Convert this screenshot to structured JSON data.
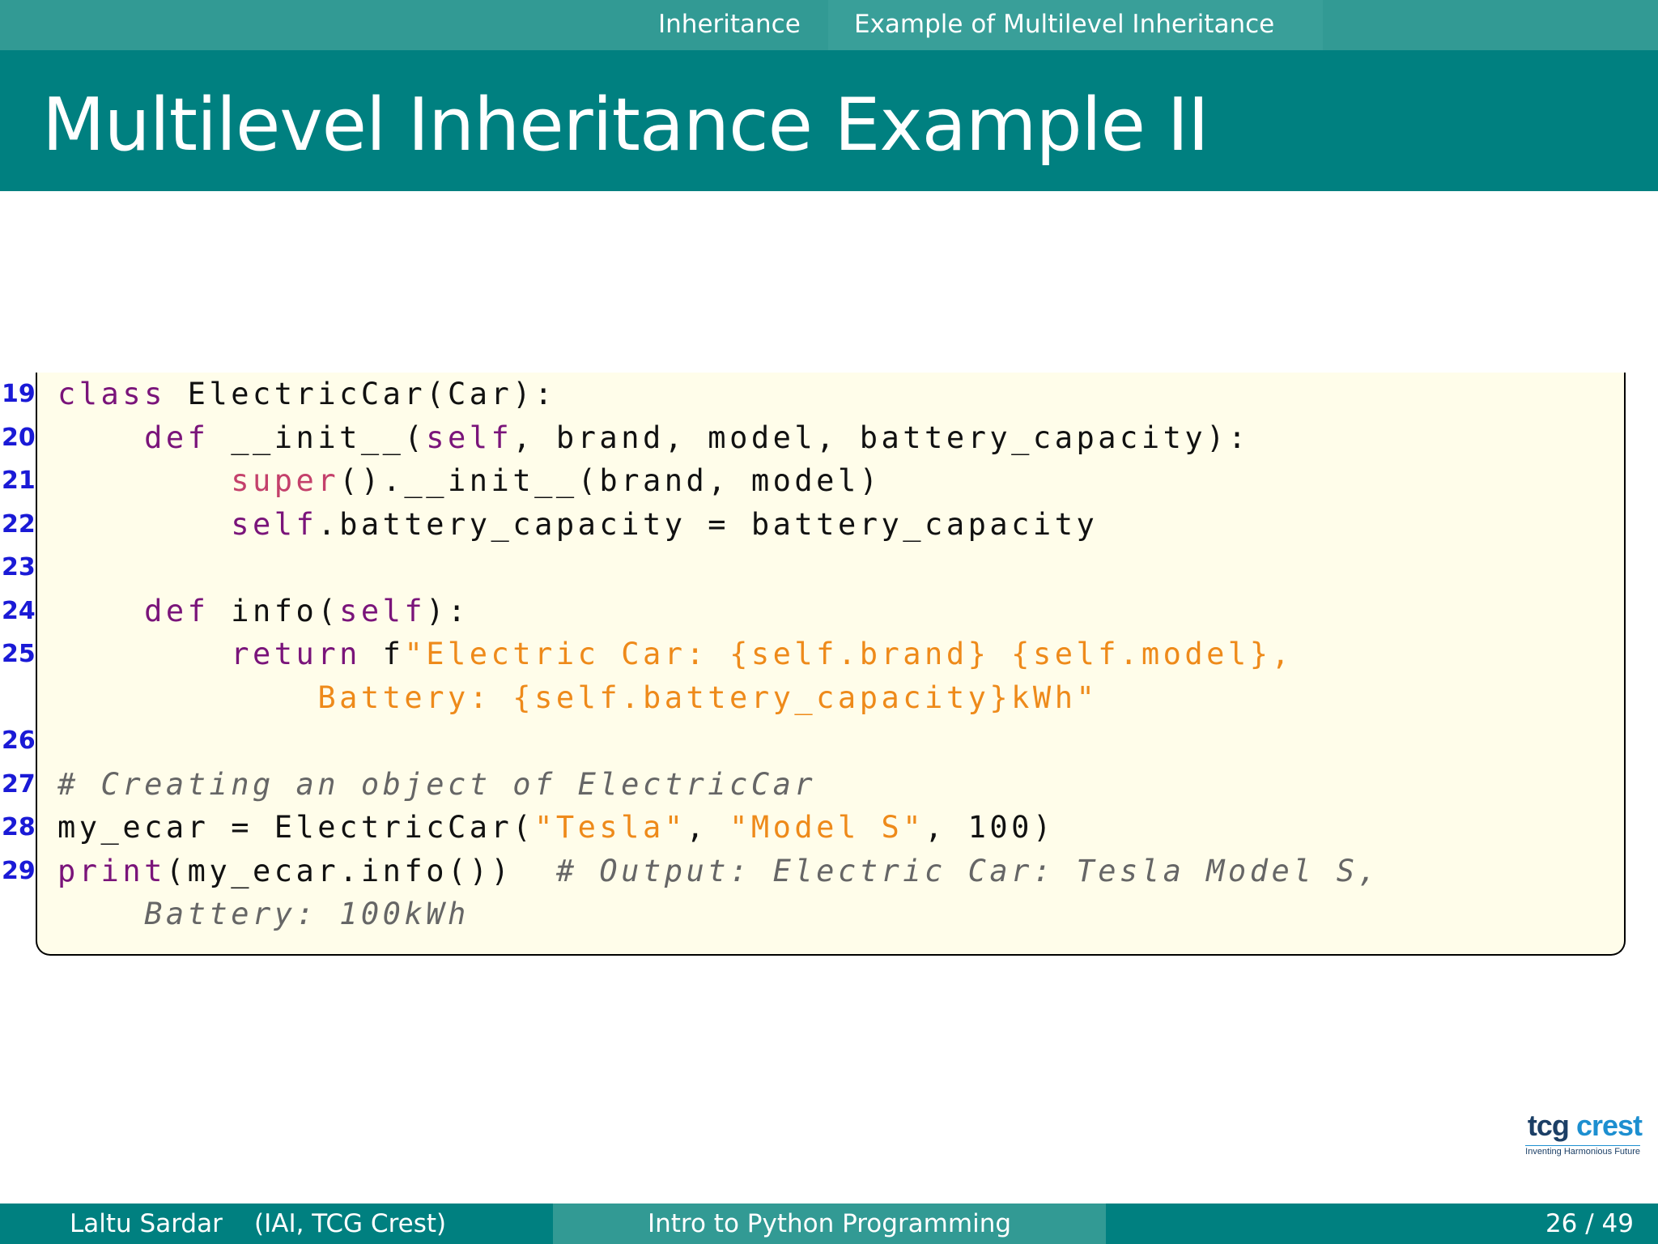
{
  "nav": {
    "section": "Inheritance",
    "subsection": "Example of Multilevel Inheritance"
  },
  "slide": {
    "title": "Multilevel Inheritance Example II"
  },
  "code": {
    "lines": [
      {
        "no": "19",
        "tokens": [
          {
            "t": "class",
            "c": "kw"
          },
          {
            "t": " ElectricCar(Car):",
            "c": ""
          }
        ]
      },
      {
        "no": "20",
        "tokens": [
          {
            "t": "    ",
            "c": ""
          },
          {
            "t": "def",
            "c": "kw"
          },
          {
            "t": " __init__(",
            "c": ""
          },
          {
            "t": "self",
            "c": "kw"
          },
          {
            "t": ", brand, model, battery_capacity):",
            "c": ""
          }
        ]
      },
      {
        "no": "21",
        "tokens": [
          {
            "t": "        ",
            "c": ""
          },
          {
            "t": "super",
            "c": "bi"
          },
          {
            "t": "().__init__(brand, model)",
            "c": ""
          }
        ]
      },
      {
        "no": "22",
        "tokens": [
          {
            "t": "        ",
            "c": ""
          },
          {
            "t": "self",
            "c": "kw"
          },
          {
            "t": ".battery_capacity = battery_capacity",
            "c": ""
          }
        ]
      },
      {
        "no": "23",
        "tokens": []
      },
      {
        "no": "24",
        "tokens": [
          {
            "t": "    ",
            "c": ""
          },
          {
            "t": "def",
            "c": "kw"
          },
          {
            "t": " info(",
            "c": ""
          },
          {
            "t": "self",
            "c": "kw"
          },
          {
            "t": "):",
            "c": ""
          }
        ]
      },
      {
        "no": "25",
        "tokens": [
          {
            "t": "        ",
            "c": ""
          },
          {
            "t": "return",
            "c": "kw"
          },
          {
            "t": " f",
            "c": ""
          },
          {
            "t": "\"Electric Car: {self.brand} {self.model},",
            "c": "str"
          }
        ]
      },
      {
        "no": "",
        "tokens": [
          {
            "t": "            ",
            "c": ""
          },
          {
            "t": "Battery: {self.battery_capacity}kWh\"",
            "c": "str"
          }
        ]
      },
      {
        "no": "26",
        "tokens": []
      },
      {
        "no": "27",
        "tokens": [
          {
            "t": "# Creating an object of ElectricCar",
            "c": "cm"
          }
        ]
      },
      {
        "no": "28",
        "tokens": [
          {
            "t": "my_ecar = ElectricCar(",
            "c": ""
          },
          {
            "t": "\"Tesla\"",
            "c": "str"
          },
          {
            "t": ", ",
            "c": ""
          },
          {
            "t": "\"Model S\"",
            "c": "str"
          },
          {
            "t": ", 100)",
            "c": ""
          }
        ]
      },
      {
        "no": "29",
        "tokens": [
          {
            "t": "print",
            "c": "kw"
          },
          {
            "t": "(my_ecar.info())  ",
            "c": ""
          },
          {
            "t": "# Output: Electric Car: Tesla Model S,",
            "c": "cm"
          }
        ]
      },
      {
        "no": "",
        "tokens": [
          {
            "t": "    ",
            "c": ""
          },
          {
            "t": "Battery: 100kWh",
            "c": "cm"
          }
        ]
      }
    ]
  },
  "logo": {
    "word1": "tcg",
    "word2": "crest",
    "tagline": "Inventing Harmonious Future"
  },
  "footer": {
    "author": "Laltu Sardar",
    "institute": "(IAI, TCG Crest)",
    "course": "Intro to Python Programming",
    "pages": "26 / 49"
  }
}
